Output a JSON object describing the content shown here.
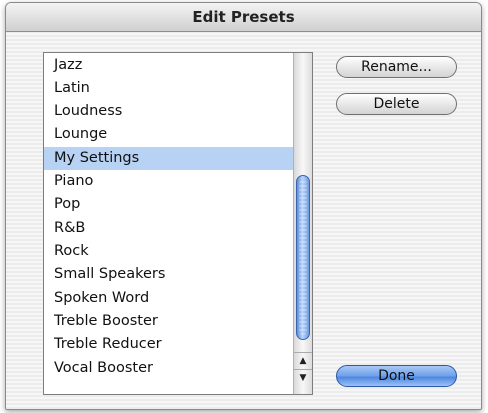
{
  "window": {
    "title": "Edit Presets"
  },
  "presets": {
    "items": [
      "Jazz",
      "Latin",
      "Loudness",
      "Lounge",
      "My Settings",
      "Piano",
      "Pop",
      "R&B",
      "Rock",
      "Small Speakers",
      "Spoken Word",
      "Treble Booster",
      "Treble Reducer",
      "Vocal Booster"
    ],
    "selected": "My Settings"
  },
  "buttons": {
    "rename": "Rename...",
    "delete": "Delete",
    "done": "Done"
  },
  "colors": {
    "selection": "#b8d2f3",
    "default_button": "#6fa0ea"
  }
}
